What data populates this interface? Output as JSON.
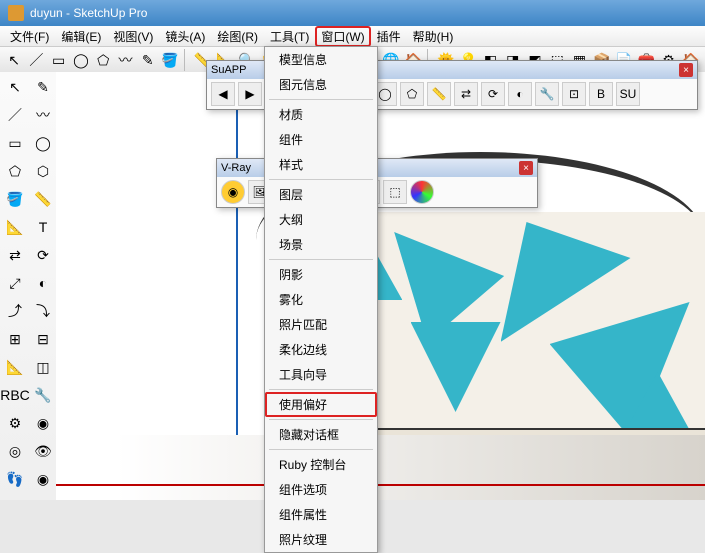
{
  "title": "duyun - SketchUp Pro",
  "menubar": [
    "文件(F)",
    "编辑(E)",
    "视图(V)",
    "镜头(A)",
    "绘图(R)",
    "工具(T)",
    "窗口(W)",
    "插件",
    "帮助(H)"
  ],
  "menubar_hl_index": 6,
  "dropdown": {
    "groups": [
      [
        "模型信息",
        "图元信息"
      ],
      [
        "材质",
        "组件",
        "样式"
      ],
      [
        "图层",
        "大纲",
        "场景"
      ],
      [
        "阴影",
        "雾化",
        "照片匹配",
        "柔化边线",
        "工具向导"
      ],
      [
        "使用偏好"
      ],
      [
        "隐藏对话框"
      ],
      [
        "Ruby 控制台",
        "组件选项",
        "组件属性",
        "照片纹理"
      ]
    ],
    "hl_text": "使用偏好"
  },
  "float_windows": {
    "suapp": {
      "title": "SuAPP"
    },
    "vray": {
      "title": "V-Ray"
    }
  },
  "toolbar_icons": [
    "↖",
    "／",
    "▭",
    "◯",
    "⬠",
    "〰",
    "✎",
    "🪣",
    "📏",
    "📐",
    "🔍",
    "🖐",
    "⟳",
    "🔎",
    "🔄",
    "👁",
    "🌐",
    "🏠",
    "🌞",
    "💡",
    "◧",
    "◨",
    "◩",
    "⬚",
    "▦",
    "📦",
    "📄",
    "🧰",
    "⚙",
    "🏠"
  ],
  "palette_icons": [
    "↖",
    "✎",
    "／",
    "〰",
    "▭",
    "◯",
    "⬠",
    "⬡",
    "🪣",
    "📏",
    "📐",
    "T",
    "⇄",
    "⟳",
    "⤢",
    "◐",
    "⤴",
    "⤵",
    "⊞",
    "⊟",
    "📐",
    "◫",
    "RBC",
    "🔧",
    "⚙",
    "◉",
    "◎",
    "👁",
    "👣",
    "◉"
  ]
}
